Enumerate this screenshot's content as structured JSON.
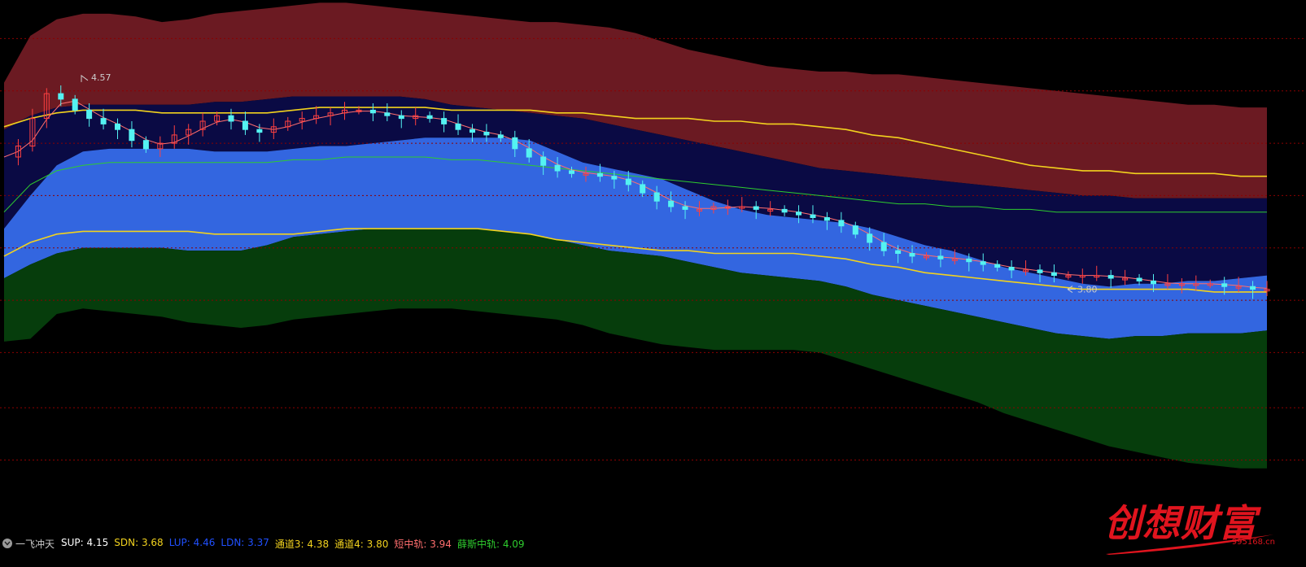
{
  "colors": {
    "background": "#000000",
    "pressure_band": "#6b1a22",
    "upper_channel": "#0a0a44",
    "mid_band": "#3366e0",
    "support_band": "#063d0c",
    "yellow_lines": "#f2d21e",
    "green_line": "#2ecc2e",
    "short_ma": "#ff6e6e",
    "candle_up": "#ff4040",
    "candle_down": "#54f2f2",
    "grid": "#8b0000",
    "watermark": "#e0141e"
  },
  "status_bar": {
    "collapse_icon": "chevron-down-icon",
    "indicator_name": "一飞冲天",
    "items": [
      {
        "label": "SUP:",
        "value": "4.15",
        "color": "#ffffff"
      },
      {
        "label": "SDN:",
        "value": "3.68",
        "color": "#f2d21e"
      },
      {
        "label": "LUP:",
        "value": "4.46",
        "color": "#2050ff"
      },
      {
        "label": "LDN:",
        "value": "3.37",
        "color": "#2050ff"
      },
      {
        "label": "通道3:",
        "value": "4.38",
        "color": "#f2d21e"
      },
      {
        "label": "通道4:",
        "value": "3.80",
        "color": "#f2d21e"
      },
      {
        "label": "短中轨:",
        "value": "3.94",
        "color": "#ff6e6e"
      },
      {
        "label": "薛斯中轨:",
        "value": "4.09",
        "color": "#2ecc2e"
      }
    ]
  },
  "watermark": {
    "text": "创想财富",
    "url": "995168.cn"
  },
  "chart_data": {
    "type": "candlestick",
    "annotations": [
      {
        "label": "4.57",
        "kind": "high",
        "y": 4.57
      },
      {
        "label": "3.80",
        "kind": "low",
        "y": 3.8
      }
    ],
    "series": [
      {
        "name": "SUP",
        "last": 4.15
      },
      {
        "name": "SDN",
        "last": 3.68
      },
      {
        "name": "LUP",
        "last": 4.46
      },
      {
        "name": "LDN",
        "last": 3.37
      },
      {
        "name": "通道3",
        "last": 4.38
      },
      {
        "name": "通道4",
        "last": 3.8
      },
      {
        "name": "短中轨",
        "last": 3.94
      },
      {
        "name": "薛斯中轨",
        "last": 4.09
      }
    ],
    "ylim": [
      2.96,
      4.85
    ],
    "grid": true,
    "close": [
      4.28,
      4.32,
      4.42,
      4.51,
      4.49,
      4.45,
      4.42,
      4.4,
      4.38,
      4.34,
      4.31,
      4.33,
      4.36,
      4.38,
      4.41,
      4.43,
      4.41,
      4.38,
      4.37,
      4.39,
      4.41,
      4.42,
      4.43,
      4.44,
      4.45,
      4.45,
      4.44,
      4.43,
      4.42,
      4.43,
      4.42,
      4.4,
      4.38,
      4.37,
      4.36,
      4.35,
      4.31,
      4.28,
      4.25,
      4.23,
      4.22,
      4.22,
      4.21,
      4.2,
      4.18,
      4.15,
      4.12,
      4.1,
      4.09,
      4.09,
      4.1,
      4.1,
      4.1,
      4.09,
      4.09,
      4.08,
      4.07,
      4.06,
      4.05,
      4.03,
      4.0,
      3.97,
      3.94,
      3.93,
      3.92,
      3.92,
      3.91,
      3.91,
      3.9,
      3.89,
      3.88,
      3.87,
      3.87,
      3.86,
      3.85,
      3.85,
      3.85,
      3.85,
      3.84,
      3.84,
      3.83,
      3.82,
      3.82,
      3.82,
      3.82,
      3.82,
      3.81,
      3.81,
      3.8,
      3.8
    ],
    "pressure_top": [
      4.55,
      4.72,
      4.78,
      4.8,
      4.8,
      4.79,
      4.77,
      4.78,
      4.8,
      4.81,
      4.82,
      4.83,
      4.84,
      4.84,
      4.83,
      4.82,
      4.81,
      4.8,
      4.79,
      4.78,
      4.77,
      4.77,
      4.76,
      4.75,
      4.73,
      4.7,
      4.67,
      4.65,
      4.63,
      4.61,
      4.6,
      4.59,
      4.59,
      4.58,
      4.58,
      4.57,
      4.56,
      4.55,
      4.54,
      4.53,
      4.52,
      4.51,
      4.5,
      4.49,
      4.48,
      4.47,
      4.47,
      4.46,
      4.46
    ],
    "channel_top": [
      4.38,
      4.43,
      4.46,
      4.47,
      4.47,
      4.47,
      4.47,
      4.47,
      4.48,
      4.48,
      4.49,
      4.5,
      4.5,
      4.5,
      4.5,
      4.5,
      4.49,
      4.47,
      4.46,
      4.45,
      4.44,
      4.43,
      4.42,
      4.4,
      4.38,
      4.36,
      4.34,
      4.32,
      4.3,
      4.28,
      4.26,
      4.24,
      4.23,
      4.22,
      4.21,
      4.2,
      4.19,
      4.18,
      4.17,
      4.16,
      4.15,
      4.14,
      4.14,
      4.13,
      4.13,
      4.13,
      4.13,
      4.13,
      4.13
    ],
    "blue_top": [
      4.02,
      4.14,
      4.25,
      4.3,
      4.31,
      4.31,
      4.31,
      4.31,
      4.3,
      4.3,
      4.3,
      4.31,
      4.32,
      4.32,
      4.33,
      4.34,
      4.35,
      4.35,
      4.35,
      4.35,
      4.34,
      4.3,
      4.26,
      4.24,
      4.22,
      4.2,
      4.16,
      4.12,
      4.09,
      4.07,
      4.06,
      4.05,
      4.04,
      4.02,
      3.99,
      3.96,
      3.94,
      3.91,
      3.88,
      3.86,
      3.84,
      3.82,
      3.81,
      3.82,
      3.82,
      3.83,
      3.83,
      3.84,
      3.85
    ],
    "blue_bottom": [
      3.84,
      3.89,
      3.93,
      3.95,
      3.95,
      3.95,
      3.95,
      3.94,
      3.94,
      3.94,
      3.96,
      3.99,
      4.0,
      4.01,
      4.02,
      4.02,
      4.02,
      4.02,
      4.02,
      4.01,
      4.0,
      3.98,
      3.96,
      3.94,
      3.93,
      3.92,
      3.9,
      3.88,
      3.86,
      3.85,
      3.84,
      3.83,
      3.81,
      3.78,
      3.76,
      3.74,
      3.72,
      3.7,
      3.68,
      3.66,
      3.64,
      3.63,
      3.62,
      3.63,
      3.63,
      3.64,
      3.64,
      3.64,
      3.65
    ],
    "green_bottom": [
      3.61,
      3.62,
      3.71,
      3.73,
      3.72,
      3.71,
      3.7,
      3.68,
      3.67,
      3.66,
      3.67,
      3.69,
      3.7,
      3.71,
      3.72,
      3.73,
      3.73,
      3.73,
      3.72,
      3.71,
      3.7,
      3.69,
      3.67,
      3.64,
      3.62,
      3.6,
      3.59,
      3.58,
      3.58,
      3.58,
      3.58,
      3.57,
      3.54,
      3.51,
      3.48,
      3.45,
      3.42,
      3.39,
      3.35,
      3.32,
      3.29,
      3.26,
      3.23,
      3.21,
      3.19,
      3.17,
      3.16,
      3.15,
      3.15
    ],
    "yellow_up": [
      4.39,
      4.42,
      4.44,
      4.45,
      4.45,
      4.45,
      4.44,
      4.44,
      4.44,
      4.44,
      4.44,
      4.45,
      4.46,
      4.46,
      4.46,
      4.46,
      4.46,
      4.45,
      4.45,
      4.45,
      4.45,
      4.44,
      4.44,
      4.43,
      4.42,
      4.42,
      4.42,
      4.41,
      4.41,
      4.4,
      4.4,
      4.39,
      4.38,
      4.36,
      4.35,
      4.33,
      4.31,
      4.29,
      4.27,
      4.25,
      4.24,
      4.23,
      4.23,
      4.22,
      4.22,
      4.22,
      4.22,
      4.21,
      4.21
    ],
    "yellow_dn": [
      3.92,
      3.97,
      4.0,
      4.01,
      4.01,
      4.01,
      4.01,
      4.01,
      4.0,
      4.0,
      4.0,
      4.0,
      4.01,
      4.02,
      4.02,
      4.02,
      4.02,
      4.02,
      4.02,
      4.01,
      4.0,
      3.98,
      3.97,
      3.96,
      3.95,
      3.94,
      3.94,
      3.93,
      3.93,
      3.93,
      3.93,
      3.92,
      3.91,
      3.89,
      3.88,
      3.86,
      3.85,
      3.84,
      3.83,
      3.82,
      3.81,
      3.8,
      3.8,
      3.8,
      3.8,
      3.8,
      3.79,
      3.79,
      3.79
    ],
    "green_mid": [
      4.08,
      4.18,
      4.23,
      4.25,
      4.26,
      4.26,
      4.26,
      4.26,
      4.26,
      4.26,
      4.26,
      4.27,
      4.27,
      4.28,
      4.28,
      4.28,
      4.28,
      4.27,
      4.27,
      4.26,
      4.25,
      4.24,
      4.23,
      4.22,
      4.21,
      4.2,
      4.19,
      4.18,
      4.17,
      4.16,
      4.15,
      4.14,
      4.13,
      4.12,
      4.11,
      4.11,
      4.1,
      4.1,
      4.09,
      4.09,
      4.08,
      4.08,
      4.08,
      4.08,
      4.08,
      4.08,
      4.08,
      4.08,
      4.08
    ]
  }
}
